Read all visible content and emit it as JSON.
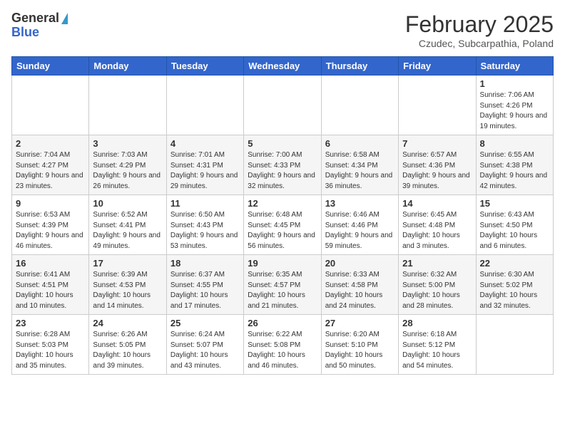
{
  "header": {
    "logo_general": "General",
    "logo_blue": "Blue",
    "month_title": "February 2025",
    "location": "Czudec, Subcarpathia, Poland"
  },
  "weekdays": [
    "Sunday",
    "Monday",
    "Tuesday",
    "Wednesday",
    "Thursday",
    "Friday",
    "Saturday"
  ],
  "weeks": [
    [
      {
        "day": "",
        "info": ""
      },
      {
        "day": "",
        "info": ""
      },
      {
        "day": "",
        "info": ""
      },
      {
        "day": "",
        "info": ""
      },
      {
        "day": "",
        "info": ""
      },
      {
        "day": "",
        "info": ""
      },
      {
        "day": "1",
        "info": "Sunrise: 7:06 AM\nSunset: 4:26 PM\nDaylight: 9 hours\nand 19 minutes."
      }
    ],
    [
      {
        "day": "2",
        "info": "Sunrise: 7:04 AM\nSunset: 4:27 PM\nDaylight: 9 hours\nand 23 minutes."
      },
      {
        "day": "3",
        "info": "Sunrise: 7:03 AM\nSunset: 4:29 PM\nDaylight: 9 hours\nand 26 minutes."
      },
      {
        "day": "4",
        "info": "Sunrise: 7:01 AM\nSunset: 4:31 PM\nDaylight: 9 hours\nand 29 minutes."
      },
      {
        "day": "5",
        "info": "Sunrise: 7:00 AM\nSunset: 4:33 PM\nDaylight: 9 hours\nand 32 minutes."
      },
      {
        "day": "6",
        "info": "Sunrise: 6:58 AM\nSunset: 4:34 PM\nDaylight: 9 hours\nand 36 minutes."
      },
      {
        "day": "7",
        "info": "Sunrise: 6:57 AM\nSunset: 4:36 PM\nDaylight: 9 hours\nand 39 minutes."
      },
      {
        "day": "8",
        "info": "Sunrise: 6:55 AM\nSunset: 4:38 PM\nDaylight: 9 hours\nand 42 minutes."
      }
    ],
    [
      {
        "day": "9",
        "info": "Sunrise: 6:53 AM\nSunset: 4:39 PM\nDaylight: 9 hours\nand 46 minutes."
      },
      {
        "day": "10",
        "info": "Sunrise: 6:52 AM\nSunset: 4:41 PM\nDaylight: 9 hours\nand 49 minutes."
      },
      {
        "day": "11",
        "info": "Sunrise: 6:50 AM\nSunset: 4:43 PM\nDaylight: 9 hours\nand 53 minutes."
      },
      {
        "day": "12",
        "info": "Sunrise: 6:48 AM\nSunset: 4:45 PM\nDaylight: 9 hours\nand 56 minutes."
      },
      {
        "day": "13",
        "info": "Sunrise: 6:46 AM\nSunset: 4:46 PM\nDaylight: 9 hours\nand 59 minutes."
      },
      {
        "day": "14",
        "info": "Sunrise: 6:45 AM\nSunset: 4:48 PM\nDaylight: 10 hours\nand 3 minutes."
      },
      {
        "day": "15",
        "info": "Sunrise: 6:43 AM\nSunset: 4:50 PM\nDaylight: 10 hours\nand 6 minutes."
      }
    ],
    [
      {
        "day": "16",
        "info": "Sunrise: 6:41 AM\nSunset: 4:51 PM\nDaylight: 10 hours\nand 10 minutes."
      },
      {
        "day": "17",
        "info": "Sunrise: 6:39 AM\nSunset: 4:53 PM\nDaylight: 10 hours\nand 14 minutes."
      },
      {
        "day": "18",
        "info": "Sunrise: 6:37 AM\nSunset: 4:55 PM\nDaylight: 10 hours\nand 17 minutes."
      },
      {
        "day": "19",
        "info": "Sunrise: 6:35 AM\nSunset: 4:57 PM\nDaylight: 10 hours\nand 21 minutes."
      },
      {
        "day": "20",
        "info": "Sunrise: 6:33 AM\nSunset: 4:58 PM\nDaylight: 10 hours\nand 24 minutes."
      },
      {
        "day": "21",
        "info": "Sunrise: 6:32 AM\nSunset: 5:00 PM\nDaylight: 10 hours\nand 28 minutes."
      },
      {
        "day": "22",
        "info": "Sunrise: 6:30 AM\nSunset: 5:02 PM\nDaylight: 10 hours\nand 32 minutes."
      }
    ],
    [
      {
        "day": "23",
        "info": "Sunrise: 6:28 AM\nSunset: 5:03 PM\nDaylight: 10 hours\nand 35 minutes."
      },
      {
        "day": "24",
        "info": "Sunrise: 6:26 AM\nSunset: 5:05 PM\nDaylight: 10 hours\nand 39 minutes."
      },
      {
        "day": "25",
        "info": "Sunrise: 6:24 AM\nSunset: 5:07 PM\nDaylight: 10 hours\nand 43 minutes."
      },
      {
        "day": "26",
        "info": "Sunrise: 6:22 AM\nSunset: 5:08 PM\nDaylight: 10 hours\nand 46 minutes."
      },
      {
        "day": "27",
        "info": "Sunrise: 6:20 AM\nSunset: 5:10 PM\nDaylight: 10 hours\nand 50 minutes."
      },
      {
        "day": "28",
        "info": "Sunrise: 6:18 AM\nSunset: 5:12 PM\nDaylight: 10 hours\nand 54 minutes."
      },
      {
        "day": "",
        "info": ""
      }
    ]
  ]
}
